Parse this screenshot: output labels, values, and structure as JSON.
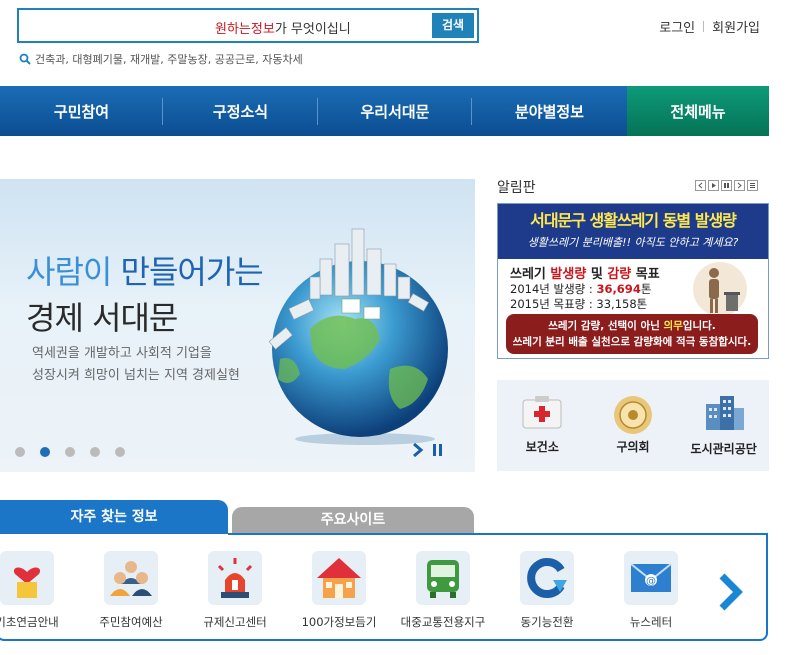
{
  "search": {
    "placeholder_highlight": "원하는정보",
    "placeholder_rest": "가 무엇이십니",
    "button": "검색",
    "keywords": "건축과, 대형폐기물, 재개발, 주말농장, 공공근로, 자동차세"
  },
  "top_links": {
    "login": "로그인",
    "join": "회원가입"
  },
  "gnb": [
    {
      "label": "구민참여"
    },
    {
      "label": "구정소식"
    },
    {
      "label": "우리서대문"
    },
    {
      "label": "분야별정보"
    },
    {
      "label": "전체메뉴"
    }
  ],
  "banner": {
    "title1_a": "사람이",
    "title1_b": "만들어가는",
    "title2": "경제 서대문",
    "desc1": "역세권을 개발하고 사회적 기업을",
    "desc2": "성장시켜 희망이 넘치는 지역 경제실현",
    "active_slide": 2,
    "slide_count": 5
  },
  "notice": {
    "title": "알림판",
    "banner_title": "서대문구 생활쓰레기 동별 발생량",
    "banner_sub": "생활쓰레기 분리배출!! 아직도 안하고 계세요?",
    "goal_a": "쓰레기",
    "goal_red1": "발생량",
    "goal_mid": "및",
    "goal_red2": "감량",
    "goal_end": "목표",
    "line1_a": "2014년 발생량 :",
    "line1_v": "36,694",
    "line1_u": "톤",
    "line2": "2015년 목표량 : 33,158톤",
    "bottom1_a": "쓰레기 감량, 선택이 아닌",
    "bottom1_y": "의무",
    "bottom1_b": "입니다.",
    "bottom2": "쓰레기 분리 배출 실천으로 감량화에 적극 동참합시다."
  },
  "quick3": [
    {
      "label": "보건소",
      "icon": "first-aid-icon"
    },
    {
      "label": "구의회",
      "icon": "seal-icon"
    },
    {
      "label": "도시관리공단",
      "icon": "building-icon"
    }
  ],
  "tabs": {
    "active": "자주 찾는 정보",
    "inactive": "주요사이트"
  },
  "quick_links": [
    {
      "label": "기초연금안내",
      "icon": "heart-pot-icon"
    },
    {
      "label": "주민참여예산",
      "icon": "people-icon"
    },
    {
      "label": "규제신고센터",
      "icon": "siren-icon"
    },
    {
      "label": "100가정보듬기",
      "icon": "house-icon"
    },
    {
      "label": "대중교통전용지구",
      "icon": "bus-icon"
    },
    {
      "label": "동기능전환",
      "icon": "cycle-arrow-icon"
    },
    {
      "label": "뉴스레터",
      "icon": "envelope-icon"
    }
  ],
  "colors": {
    "brand_blue": "#1b76c8",
    "nav_blue": "#0c4d92",
    "nav_green": "#057357",
    "red": "#c8161d"
  }
}
